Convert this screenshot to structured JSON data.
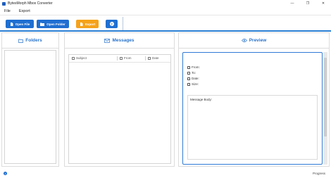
{
  "window": {
    "title": "BytesMorph Mbox Converter",
    "controls": [
      "—",
      "❐",
      "✕"
    ]
  },
  "menu": {
    "items": [
      "File",
      "Export"
    ]
  },
  "toolbar": {
    "open_file": "Open File",
    "open_folder": "Open Folder",
    "export": "Export",
    "help_icon": "?"
  },
  "folders": {
    "title": "Folders"
  },
  "messages": {
    "title": "Messages",
    "columns": [
      "Subject",
      "From",
      "Date"
    ]
  },
  "preview": {
    "title": "Preview",
    "fields": [
      "From:",
      "To:",
      "Date:",
      "Size:"
    ],
    "body_label": "Message Body:"
  },
  "status": {
    "progress_label": "Progress",
    "info_icon": "i"
  },
  "colors": {
    "accent": "#1f6fd1",
    "export": "#f5a21a",
    "header_text": "#2a74cc",
    "preview_border": "#2f7ad6"
  }
}
